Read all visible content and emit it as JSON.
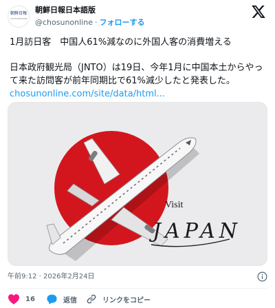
{
  "account": {
    "display_name": "朝鮮日報日本語版",
    "handle": "@chosunonline",
    "separator": "·",
    "follow_label": "フォローする",
    "avatar_text": "朝鮮日報",
    "avatar_subtext": "CHOSUNONLINE"
  },
  "tweet": {
    "headline": "1月訪日客　中国人61%減なのに外国人客の消費増える",
    "body": "日本政府観光局（JNTO）は19日、今年1月に中国本土からやって来た訪問客が前年同期比で61%減少したと発表した。",
    "link": "chosunonline.com/site/data/html..."
  },
  "media": {
    "visit_text": "Visit",
    "japan_text": "JAPAN",
    "colors": {
      "sun": "#d3161d",
      "background": "#e9e9eb"
    }
  },
  "meta": {
    "timestamp": "午前9:12 · 2026年2月24日"
  },
  "actions": {
    "like_count": "16",
    "reply_label": "返信",
    "copy_link_label": "リンクをコピー"
  },
  "colors": {
    "accent": "#1d9bf0",
    "like": "#f91880",
    "secondary_text": "#536471"
  },
  "icons": {
    "platform": "x-logo-icon",
    "info": "info-icon",
    "like": "heart-icon",
    "reply": "reply-bubble-icon",
    "copy": "link-icon"
  }
}
